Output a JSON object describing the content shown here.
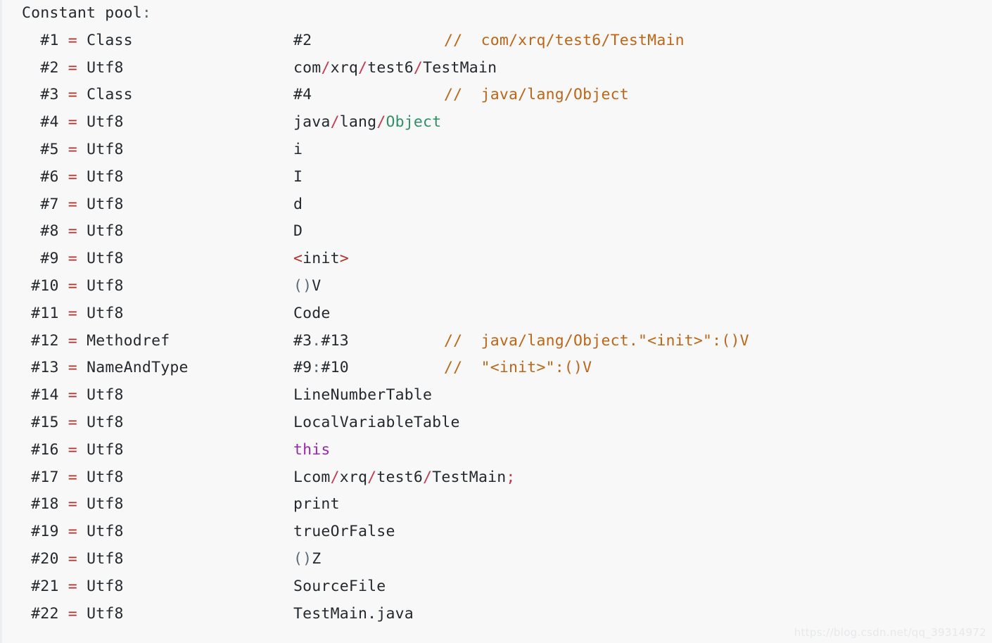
{
  "block": {
    "background_color": "#f8f8f8",
    "border_color": "#eceff1",
    "header": {
      "text": "Constant pool",
      "colon": ":"
    }
  },
  "colors": {
    "plain": "#24292e",
    "equals": "#b5302a",
    "slash": "#c7384f",
    "comment": "#bf6516",
    "type_green": "#2e9166",
    "keyword_purple": "#9c27b0",
    "punct_gray": "#5a6b78",
    "background": "#f8f8f8",
    "watermark": "#e6e8ea"
  },
  "watermark": {
    "text": "https://blog.csdn.net/qq_39314972"
  },
  "entries": [
    {
      "index": "#1",
      "eq": "=",
      "kind": "Class",
      "value_parts": [
        {
          "t": "#2",
          "c": "plain"
        }
      ],
      "comment": "//  com/xrq/test6/TestMain"
    },
    {
      "index": "#2",
      "eq": "=",
      "kind": "Utf8",
      "value_parts": [
        {
          "t": "com",
          "c": "plain"
        },
        {
          "t": "/",
          "c": "slash"
        },
        {
          "t": "xrq",
          "c": "plain"
        },
        {
          "t": "/",
          "c": "slash"
        },
        {
          "t": "test6",
          "c": "plain"
        },
        {
          "t": "/",
          "c": "slash"
        },
        {
          "t": "TestMain",
          "c": "plain"
        }
      ],
      "comment": ""
    },
    {
      "index": "#3",
      "eq": "=",
      "kind": "Class",
      "value_parts": [
        {
          "t": "#4",
          "c": "plain"
        }
      ],
      "comment": "//  java/lang/Object"
    },
    {
      "index": "#4",
      "eq": "=",
      "kind": "Utf8",
      "value_parts": [
        {
          "t": "java",
          "c": "plain"
        },
        {
          "t": "/",
          "c": "slash"
        },
        {
          "t": "lang",
          "c": "plain"
        },
        {
          "t": "/",
          "c": "slash"
        },
        {
          "t": "Object",
          "c": "type_green"
        }
      ],
      "comment": ""
    },
    {
      "index": "#5",
      "eq": "=",
      "kind": "Utf8",
      "value_parts": [
        {
          "t": "i",
          "c": "plain"
        }
      ],
      "comment": ""
    },
    {
      "index": "#6",
      "eq": "=",
      "kind": "Utf8",
      "value_parts": [
        {
          "t": "I",
          "c": "plain"
        }
      ],
      "comment": ""
    },
    {
      "index": "#7",
      "eq": "=",
      "kind": "Utf8",
      "value_parts": [
        {
          "t": "d",
          "c": "plain"
        }
      ],
      "comment": ""
    },
    {
      "index": "#8",
      "eq": "=",
      "kind": "Utf8",
      "value_parts": [
        {
          "t": "D",
          "c": "plain"
        }
      ],
      "comment": ""
    },
    {
      "index": "#9",
      "eq": "=",
      "kind": "Utf8",
      "value_parts": [
        {
          "t": "<",
          "c": "equals"
        },
        {
          "t": "init",
          "c": "plain"
        },
        {
          "t": ">",
          "c": "equals"
        }
      ],
      "comment": ""
    },
    {
      "index": "#10",
      "eq": "=",
      "kind": "Utf8",
      "value_parts": [
        {
          "t": "()",
          "c": "punct_gray"
        },
        {
          "t": "V",
          "c": "plain"
        }
      ],
      "comment": ""
    },
    {
      "index": "#11",
      "eq": "=",
      "kind": "Utf8",
      "value_parts": [
        {
          "t": "Code",
          "c": "plain"
        }
      ],
      "comment": ""
    },
    {
      "index": "#12",
      "eq": "=",
      "kind": "Methodref",
      "value_parts": [
        {
          "t": "#3",
          "c": "plain"
        },
        {
          "t": ".",
          "c": "punct_gray"
        },
        {
          "t": "#13",
          "c": "plain"
        }
      ],
      "comment": "//  java/lang/Object.\"<init>\":()V"
    },
    {
      "index": "#13",
      "eq": "=",
      "kind": "NameAndType",
      "value_parts": [
        {
          "t": "#9",
          "c": "plain"
        },
        {
          "t": ":",
          "c": "punct_gray"
        },
        {
          "t": "#10",
          "c": "plain"
        }
      ],
      "comment": "//  \"<init>\":()V"
    },
    {
      "index": "#14",
      "eq": "=",
      "kind": "Utf8",
      "value_parts": [
        {
          "t": "LineNumberTable",
          "c": "plain"
        }
      ],
      "comment": ""
    },
    {
      "index": "#15",
      "eq": "=",
      "kind": "Utf8",
      "value_parts": [
        {
          "t": "LocalVariableTable",
          "c": "plain"
        }
      ],
      "comment": ""
    },
    {
      "index": "#16",
      "eq": "=",
      "kind": "Utf8",
      "value_parts": [
        {
          "t": "this",
          "c": "keyword_purple"
        }
      ],
      "comment": ""
    },
    {
      "index": "#17",
      "eq": "=",
      "kind": "Utf8",
      "value_parts": [
        {
          "t": "Lcom",
          "c": "plain"
        },
        {
          "t": "/",
          "c": "slash"
        },
        {
          "t": "xrq",
          "c": "plain"
        },
        {
          "t": "/",
          "c": "slash"
        },
        {
          "t": "test6",
          "c": "plain"
        },
        {
          "t": "/",
          "c": "slash"
        },
        {
          "t": "TestMain",
          "c": "plain"
        },
        {
          "t": ";",
          "c": "slash"
        }
      ],
      "comment": ""
    },
    {
      "index": "#18",
      "eq": "=",
      "kind": "Utf8",
      "value_parts": [
        {
          "t": "print",
          "c": "plain"
        }
      ],
      "comment": ""
    },
    {
      "index": "#19",
      "eq": "=",
      "kind": "Utf8",
      "value_parts": [
        {
          "t": "trueOrFalse",
          "c": "plain"
        }
      ],
      "comment": ""
    },
    {
      "index": "#20",
      "eq": "=",
      "kind": "Utf8",
      "value_parts": [
        {
          "t": "()",
          "c": "punct_gray"
        },
        {
          "t": "Z",
          "c": "plain"
        }
      ],
      "comment": ""
    },
    {
      "index": "#21",
      "eq": "=",
      "kind": "Utf8",
      "value_parts": [
        {
          "t": "SourceFile",
          "c": "plain"
        }
      ],
      "comment": ""
    },
    {
      "index": "#22",
      "eq": "=",
      "kind": "Utf8",
      "value_parts": [
        {
          "t": "TestMain",
          "c": "plain"
        },
        {
          "t": ".",
          "c": "plain"
        },
        {
          "t": "java",
          "c": "plain"
        }
      ],
      "comment": ""
    }
  ]
}
